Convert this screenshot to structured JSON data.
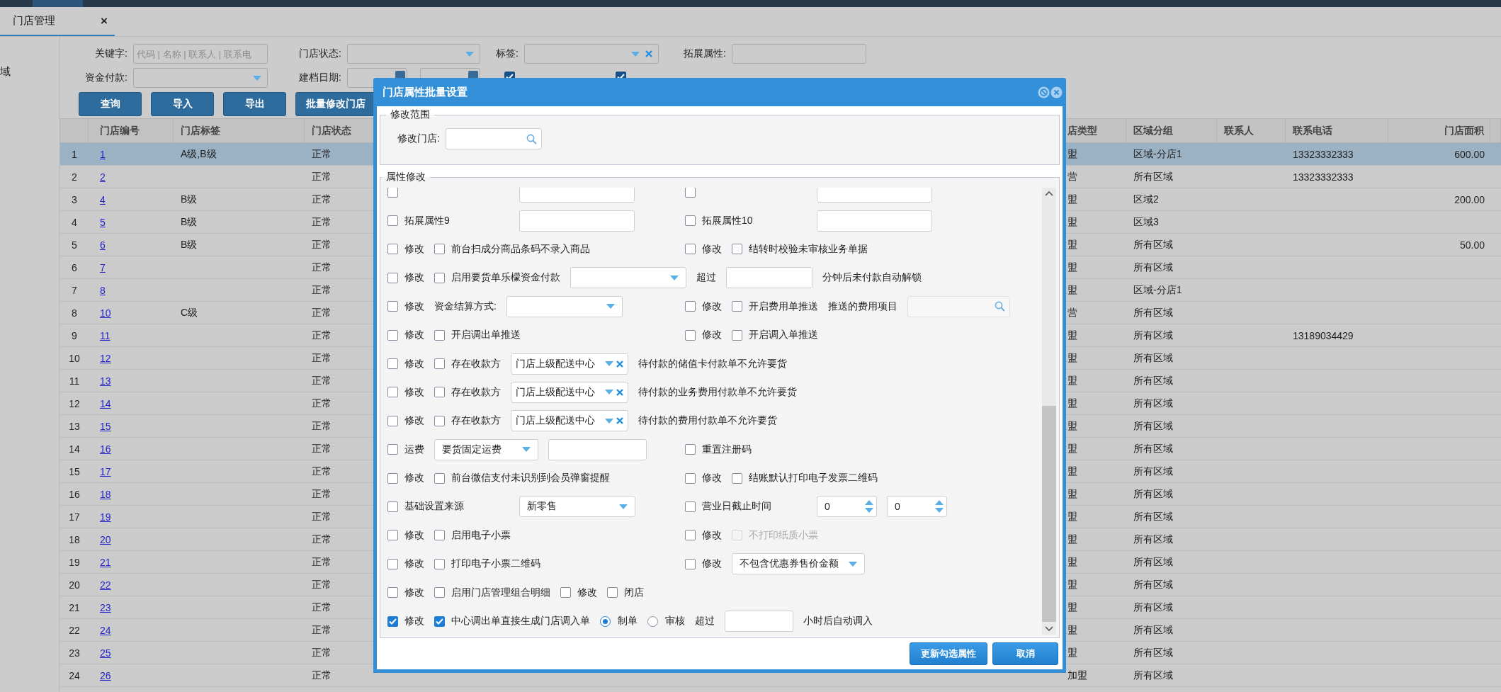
{
  "tabs": [
    {
      "label": "门店管理",
      "selected": true,
      "close": "×"
    }
  ],
  "sidebar": {
    "items": [
      {
        "label": "域"
      }
    ]
  },
  "filter_rows": [
    [
      {
        "kind": "label",
        "text": "关键字:"
      },
      {
        "kind": "input",
        "placeholder": "代码 | 名称 | 联系人 | 联系电"
      },
      {
        "kind": "label",
        "text": "门店状态:"
      },
      {
        "kind": "select"
      },
      {
        "kind": "label",
        "text": "标签:"
      },
      {
        "kind": "select",
        "clearable": true
      },
      {
        "kind": "label",
        "text": "拓展属性:"
      },
      {
        "kind": "input"
      }
    ],
    [
      {
        "kind": "label",
        "text": "资金付款:"
      },
      {
        "kind": "select"
      },
      {
        "kind": "label",
        "text": "建档日期:"
      },
      {
        "kind": "date"
      },
      {
        "kind": "date"
      },
      {
        "kind": "checkbox",
        "checked": true
      },
      {
        "kind": "checkbox",
        "checked": true
      }
    ]
  ],
  "toolbar": {
    "buttons": [
      {
        "label": "查询"
      },
      {
        "label": "导入"
      },
      {
        "label": "导出"
      },
      {
        "label": "批量修改门店"
      }
    ]
  },
  "table": {
    "columns": [
      {
        "kind": "index"
      },
      {
        "kind": "link",
        "label": "门店编号"
      },
      {
        "kind": "text",
        "label": "门店标签"
      },
      {
        "kind": "text",
        "label": "门店状态"
      },
      {
        "kind": "text",
        "label": "店类型"
      },
      {
        "kind": "text",
        "label": "区域分组"
      },
      {
        "kind": "text",
        "label": "联系人"
      },
      {
        "kind": "text",
        "label": "联系电话"
      },
      {
        "kind": "number",
        "label": "门店面积"
      }
    ],
    "rows": [
      {
        "cells": [
          "1",
          "1",
          "A级,B级",
          "正常",
          "盟",
          "区域-分店1",
          null,
          "13323332333",
          "600.00"
        ],
        "selected": true
      },
      {
        "cells": [
          "2",
          "2",
          null,
          "正常",
          "营",
          "所有区域",
          null,
          "13323332333",
          null
        ],
        "selected": false
      },
      {
        "cells": [
          "3",
          "4",
          "B级",
          "正常",
          "盟",
          "区域2",
          null,
          null,
          "200.00"
        ],
        "selected": false
      },
      {
        "cells": [
          "4",
          "5",
          "B级",
          "正常",
          "盟",
          "区域3",
          null,
          null,
          null
        ],
        "selected": false
      },
      {
        "cells": [
          "5",
          "6",
          "B级",
          "正常",
          "盟",
          "所有区域",
          null,
          null,
          "50.00"
        ],
        "selected": false
      },
      {
        "cells": [
          "6",
          "7",
          null,
          "正常",
          "盟",
          "所有区域",
          null,
          null,
          null
        ],
        "selected": false
      },
      {
        "cells": [
          "7",
          "8",
          null,
          "正常",
          "盟",
          "区域-分店1",
          null,
          null,
          null
        ],
        "selected": false
      },
      {
        "cells": [
          "8",
          "10",
          "C级",
          "正常",
          "营",
          "所有区域",
          null,
          null,
          null
        ],
        "selected": false
      },
      {
        "cells": [
          "9",
          "11",
          null,
          "正常",
          "盟",
          "所有区域",
          null,
          "13189034429",
          null
        ],
        "selected": false
      },
      {
        "cells": [
          "10",
          "12",
          null,
          "正常",
          "盟",
          "所有区域",
          null,
          null,
          null
        ],
        "selected": false
      },
      {
        "cells": [
          "11",
          "13",
          null,
          "正常",
          "盟",
          "所有区域",
          null,
          null,
          null
        ],
        "selected": false
      },
      {
        "cells": [
          "12",
          "14",
          null,
          "正常",
          "盟",
          "所有区域",
          null,
          null,
          null
        ],
        "selected": false
      },
      {
        "cells": [
          "13",
          "15",
          null,
          "正常",
          "盟",
          "所有区域",
          null,
          null,
          null
        ],
        "selected": false
      },
      {
        "cells": [
          "14",
          "16",
          null,
          "正常",
          "盟",
          "所有区域",
          null,
          null,
          null
        ],
        "selected": false
      },
      {
        "cells": [
          "15",
          "17",
          null,
          "正常",
          "盟",
          "所有区域",
          null,
          null,
          null
        ],
        "selected": false
      },
      {
        "cells": [
          "16",
          "18",
          null,
          "正常",
          "盟",
          "所有区域",
          null,
          null,
          null
        ],
        "selected": false
      },
      {
        "cells": [
          "17",
          "19",
          null,
          "正常",
          "盟",
          "所有区域",
          null,
          null,
          null
        ],
        "selected": false
      },
      {
        "cells": [
          "18",
          "20",
          null,
          "正常",
          "盟",
          "所有区域",
          null,
          null,
          null
        ],
        "selected": false
      },
      {
        "cells": [
          "19",
          "21",
          null,
          "正常",
          "盟",
          "所有区域",
          null,
          null,
          null
        ],
        "selected": false
      },
      {
        "cells": [
          "20",
          "22",
          null,
          "正常",
          "盟",
          "所有区域",
          null,
          null,
          null
        ],
        "selected": false
      },
      {
        "cells": [
          "21",
          "23",
          null,
          "正常",
          "盟",
          "所有区域",
          null,
          null,
          null
        ],
        "selected": false
      },
      {
        "cells": [
          "22",
          "24",
          null,
          "正常",
          "盟",
          "所有区域",
          null,
          null,
          null
        ],
        "selected": false
      },
      {
        "cells": [
          "23",
          "25",
          null,
          "正常",
          "盟",
          "所有区域",
          null,
          null,
          null
        ],
        "selected": false
      },
      {
        "cells": [
          "24",
          "26",
          null,
          "正常",
          "加盟",
          "所有区域",
          null,
          null,
          null
        ],
        "selected": false
      }
    ]
  },
  "dialog": {
    "title": "门店属性批量设置",
    "scope": {
      "legend": "修改范围",
      "label": "修改门店:"
    },
    "properties": {
      "legend": "属性修改",
      "rows": [
        {
          "left": [
            {
              "kind": "field_check",
              "checked": false
            },
            {
              "kind": "input"
            }
          ],
          "right": [
            {
              "kind": "field_check",
              "checked": false
            },
            {
              "kind": "input"
            }
          ]
        },
        {
          "left": [
            {
              "kind": "field_check",
              "label": "拓展属性9",
              "checked": false
            },
            {
              "kind": "input"
            }
          ],
          "right": [
            {
              "kind": "field_check",
              "label": "拓展属性10",
              "checked": false
            },
            {
              "kind": "input"
            }
          ]
        },
        {
          "left": [
            {
              "kind": "check",
              "label": "修改",
              "checked": false
            },
            {
              "kind": "check",
              "label": "前台扫成分商品条码不录入商品",
              "checked": false
            }
          ],
          "right": [
            {
              "kind": "check",
              "label": "修改",
              "checked": false
            },
            {
              "kind": "check",
              "label": "结转时校验未审核业务单据",
              "checked": false
            }
          ]
        },
        {
          "left": [
            {
              "kind": "check",
              "label": "修改",
              "checked": false
            },
            {
              "kind": "check",
              "label": "启用要货单乐檬资金付款",
              "checked": false
            },
            {
              "kind": "select"
            }
          ],
          "right": [
            {
              "kind": "text",
              "text": "超过"
            },
            {
              "kind": "input"
            },
            {
              "kind": "text",
              "text": "分钟后未付款自动解锁"
            }
          ]
        },
        {
          "left": [
            {
              "kind": "check",
              "label": "修改",
              "checked": false
            },
            {
              "kind": "text",
              "text": "资金结算方式:"
            },
            {
              "kind": "select"
            }
          ],
          "right": [
            {
              "kind": "check",
              "label": "修改",
              "checked": false
            },
            {
              "kind": "check",
              "label": "开启费用单推送",
              "checked": false
            },
            {
              "kind": "text",
              "text": "推送的费用项目"
            },
            {
              "kind": "search",
              "disabled": true
            }
          ]
        },
        {
          "left": [
            {
              "kind": "check",
              "label": "修改",
              "checked": false
            },
            {
              "kind": "check",
              "label": "开启调出单推送",
              "checked": false
            }
          ],
          "right": [
            {
              "kind": "check",
              "label": "修改",
              "checked": false
            },
            {
              "kind": "check",
              "label": "开启调入单推送",
              "checked": false
            }
          ]
        },
        {
          "left": [
            {
              "kind": "check",
              "label": "修改",
              "checked": false
            },
            {
              "kind": "check",
              "label": "存在收款方",
              "checked": false
            },
            {
              "kind": "tagselect",
              "value": "门店上级配送中心"
            },
            {
              "kind": "text",
              "text": "待付款的储值卡付款单不允许要货"
            }
          ]
        },
        {
          "left": [
            {
              "kind": "check",
              "label": "修改",
              "checked": false
            },
            {
              "kind": "check",
              "label": "存在收款方",
              "checked": false
            },
            {
              "kind": "tagselect",
              "value": "门店上级配送中心"
            },
            {
              "kind": "text",
              "text": "待付款的业务费用付款单不允许要货"
            }
          ]
        },
        {
          "left": [
            {
              "kind": "check",
              "label": "修改",
              "checked": false
            },
            {
              "kind": "check",
              "label": "存在收款方",
              "checked": false
            },
            {
              "kind": "tagselect",
              "value": "门店上级配送中心"
            },
            {
              "kind": "text",
              "text": "待付款的费用付款单不允许要货"
            }
          ]
        },
        {
          "left": [
            {
              "kind": "check",
              "label": "运费",
              "checked": false
            },
            {
              "kind": "select",
              "value": "要货固定运费"
            },
            {
              "kind": "input"
            }
          ],
          "right": [
            {
              "kind": "check",
              "label": "重置注册码",
              "checked": false
            }
          ]
        },
        {
          "left": [
            {
              "kind": "check",
              "label": "修改",
              "checked": false
            },
            {
              "kind": "check",
              "label": "前台微信支付未识别到会员弹窗提醒",
              "checked": false
            }
          ],
          "right": [
            {
              "kind": "check",
              "label": "修改",
              "checked": false
            },
            {
              "kind": "check",
              "label": "结账默认打印电子发票二维码",
              "checked": false
            }
          ]
        },
        {
          "left": [
            {
              "kind": "field_check",
              "label": "基础设置来源",
              "checked": false
            },
            {
              "kind": "select",
              "value": "新零售"
            }
          ],
          "right": [
            {
              "kind": "field_check",
              "label": "营业日截止时间",
              "checked": false
            },
            {
              "kind": "spinner",
              "value": "0"
            },
            {
              "kind": "spinner",
              "value": "0"
            }
          ]
        },
        {
          "left": [
            {
              "kind": "check",
              "label": "修改",
              "checked": false
            },
            {
              "kind": "check",
              "label": "启用电子小票",
              "checked": false
            }
          ],
          "right": [
            {
              "kind": "check",
              "label": "修改",
              "checked": false
            },
            {
              "kind": "check",
              "label": "不打印纸质小票",
              "checked": false,
              "disabled": true
            }
          ]
        },
        {
          "left": [
            {
              "kind": "check",
              "label": "修改",
              "checked": false
            },
            {
              "kind": "check",
              "label": "打印电子小票二维码",
              "checked": false
            }
          ],
          "right": [
            {
              "kind": "check",
              "label": "修改",
              "checked": false
            },
            {
              "kind": "select",
              "value": "不包含优惠券售价金额"
            }
          ]
        },
        {
          "left": [
            {
              "kind": "check",
              "label": "修改",
              "checked": false
            },
            {
              "kind": "check",
              "label": "启用门店管理组合明细",
              "checked": false
            },
            {
              "kind": "check",
              "label": "修改",
              "checked": false
            },
            {
              "kind": "check",
              "label": "闭店",
              "checked": false
            }
          ]
        },
        {
          "left": [
            {
              "kind": "check",
              "label": "修改",
              "checked": true
            },
            {
              "kind": "check",
              "label": "中心调出单直接生成门店调入单",
              "checked": true
            },
            {
              "kind": "radio",
              "label": "制单",
              "selected": true
            },
            {
              "kind": "radio",
              "label": "审核",
              "selected": false
            },
            {
              "kind": "text",
              "text": "超过"
            },
            {
              "kind": "input"
            },
            {
              "kind": "text",
              "text": "小时后自动调入"
            }
          ]
        }
      ]
    },
    "buttons": [
      {
        "label": "更新勾选属性"
      },
      {
        "label": "取消"
      }
    ]
  }
}
